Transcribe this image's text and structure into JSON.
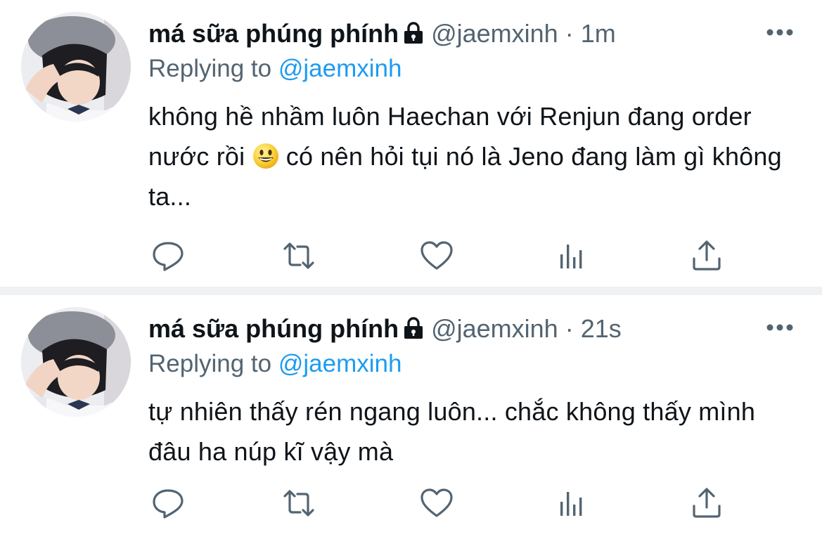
{
  "tweets": [
    {
      "display_name": "má sữa phúng phính",
      "handle": "@jaemxinh",
      "separator": "·",
      "time": "1m",
      "replying_prefix": "Replying to",
      "replying_to": "@jaemxinh",
      "text_before_emoji": "không hề nhầm luôn Haechan với Renjun đang order nước rồi ",
      "emoji": "grinning-face-emoji",
      "text_after_emoji": " có nên hỏi tụi nó là Jeno đang làm gì không ta...",
      "icons": [
        "lock-icon",
        "more-icon",
        "reply-icon",
        "retweet-icon",
        "like-icon",
        "views-icon",
        "share-icon"
      ]
    },
    {
      "display_name": "má sữa phúng phính",
      "handle": "@jaemxinh",
      "separator": "·",
      "time": "21s",
      "replying_prefix": "Replying to",
      "replying_to": "@jaemxinh",
      "text": "tự nhiên thấy rén ngang luôn... chắc không thấy mình đâu ha núp kĩ vậy mà",
      "icons": [
        "lock-icon",
        "more-icon",
        "reply-icon",
        "retweet-icon",
        "like-icon",
        "views-icon",
        "share-icon"
      ]
    }
  ],
  "colors": {
    "text": "#0f1419",
    "secondary": "#536471",
    "link": "#1d9bf0",
    "divider": "#eff1f3"
  }
}
